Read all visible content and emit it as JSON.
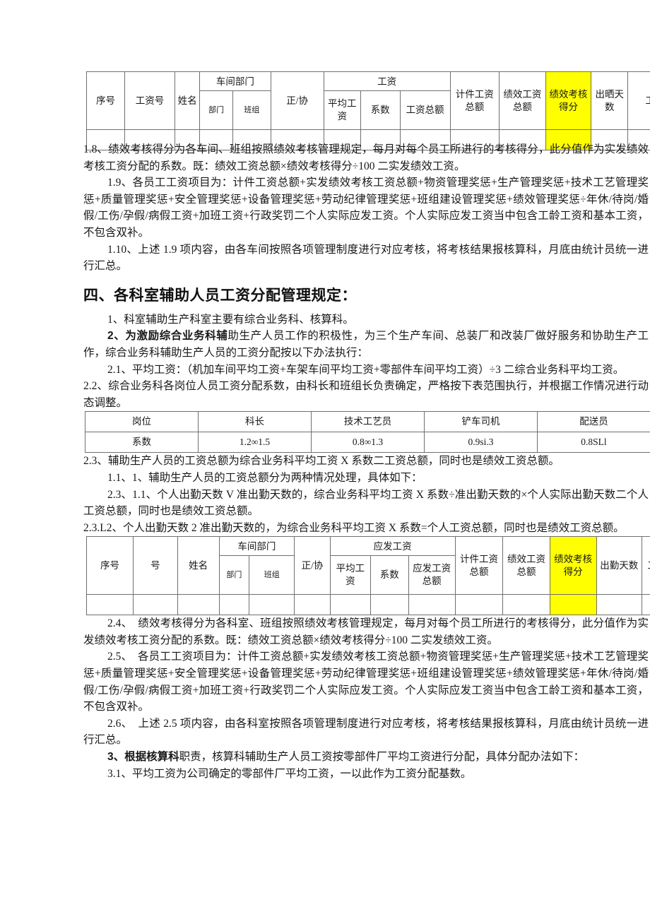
{
  "document": {
    "language": "zh-CN",
    "page_bg": "#ffffff",
    "text_color": "#1a1a1a",
    "highlight_color": "#ffff00",
    "border_color": "#6f6f6f"
  },
  "table1": {
    "name": "workshop-employee-wage-table",
    "group_headers": {
      "workshop_dept": "车间部门",
      "wage": "工资"
    },
    "headers": [
      "序号",
      "工资号",
      "姓名",
      "部门",
      "班组",
      "正/协",
      "平均工资",
      "系数",
      "工资总额",
      "计件工资总额",
      "绩效工资总额",
      "绩效考核得分",
      "出晒天数",
      "工"
    ],
    "highlighted_header": "绩效考核得分",
    "rows": [
      [
        "",
        "",
        "",
        "",
        "",
        "",
        "",
        "",
        "",
        "",
        "",
        "",
        "",
        ""
      ]
    ]
  },
  "paragraphs": {
    "p1_8": "1.8、绩效考核得分为各车间、班组按照绩效考核管理规定，每月对每个员工所进行的考核得分，此分值作为实发绩效考核工资分配的系数。既：绩效工资总额×绩效考核得分÷100 二实发绩效工资。",
    "p1_9": "1.9、各员工工资项目为：计件工资总额+实发绩效考核工资总额+物资管理奖惩+生产管理奖惩+技术工艺管理奖惩+质量管理奖惩+安全管理奖惩+设备管理奖惩+劳动纪律管理奖惩+班组建设管理奖惩+绩效管理奖惩÷年休/待岗/婚假/工伤/孕假/病假工资+加班工资+行政奖罚二个人实际应发工资。个人实际应发工资当中包含工龄工资和基本工资，不包含双补。",
    "p1_10": "1.10、上述 1.9 项内容，由各车间按照各项管理制度进行对应考核，将考核结果报核算科，月底由统计员统一进行汇总。",
    "heading4": "四、各科室辅助人员工资分配管理规定：",
    "p1": "1、科室辅助生产科室主要有综合业务科、核算科。",
    "p2_bold": "2、为激励综合业务科辅",
    "p2_rest": "助生产人员工作的积极性，为三个生产车间、总装厂和改装厂做好服务和协助生产工作，综合业务科辅助生产人员的工资分配按以下办法执行：",
    "p2_1": "2.1、平均工资：（机加车间平均工资+车架车间平均工资+零部件车间平均工资）÷3 二综合业务科平均工资。",
    "p2_2": "2.2、综合业务科各岗位人员工资分配系数，由科长和班组长负责确定，严格按下表范围执行，并根据工作情况进行动态调整。",
    "p2_3": "2.3、辅助生产人员的工资总额为综合业务科平均工资 X 系数二工资总额，同时也是绩效工资总额。",
    "p1_1": "1.1、1、辅助生产人员的工资总额分为两种情况处理，具体如下：",
    "p2_3_1_1": "2.3、1.1、个人出勤天数 V 准出勤天数的，综合业务科平均工资 X 系数÷准出勤天数的×个人实际出勤天数二个人工资总额，同时也是绩效工资总额。",
    "p2_3_l2": "2.3.L2、个人出勤天数 2 准出勤天数的，为综合业务科平均工资 X 系数=个人工资总额，同时也是绩效工资总额。",
    "p2_4": "2.4、　绩效考核得分为各科室、班组按照绩效考核管理规定，每月对每个员工所进行的考核得分，此分值作为实发绩效考核工资分配的系数。既：绩效工资总额×绩效考核得分÷100 二实发绩效工资。",
    "p2_5": "2.5、　各员工工资项目为：计件工资总额+实发绩效考核工资总额+物资管理奖惩+生产管理奖惩+技术工艺管理奖惩+质量管理奖惩+安全管理奖惩+设备管理奖惩+劳动纪律管理奖惩+班组建设管理奖惩+绩效管理奖惩+年休/待岗/婚假/工伤/孕假/病假工资+加班工资+行政奖罚二个人实际应发工资。个人实际应发工资当中包含工龄工资和基本工资，不包含双补。",
    "p2_6": "2.6、　上述 2.5 项内容，由各科室按照各项管理制度进行对应考核，将考核结果报核算科，月底由统计员统一进行汇总。",
    "p3_bold": "3、根据核算科",
    "p3_rest": "职责，核算科辅助生产人员工资按零部件厂平均工资进行分配，具体分配办法如下：",
    "p3_1": "3.1、平均工资为公司确定的零部件厂平均工资，一以此作为工资分配基数。"
  },
  "table_coefficient": {
    "name": "position-coefficient-table",
    "row_labels": [
      "岗位",
      "系数"
    ],
    "positions": [
      "科长",
      "技术工艺员",
      "铲车司机",
      "配送员"
    ],
    "coefficients": [
      "1.2∞1.5",
      "0.8∞1.3",
      "0.9si.3",
      "0.8SLl"
    ]
  },
  "table2": {
    "name": "department-assistant-wage-table",
    "group_headers": {
      "workshop_dept": "车间部门",
      "payable_wage": "应发工资"
    },
    "headers": [
      "序号",
      "号",
      "姓名",
      "部门",
      "班组",
      "正/协",
      "平均工资",
      "系数",
      "应发工资总额",
      "计件工资总额",
      "绩效工资总额",
      "绩效考核得分",
      "出勤天数",
      "工龄"
    ],
    "highlighted_header": "绩效考核得分",
    "rows": [
      [
        "",
        "",
        "",
        "",
        "",
        "",
        "",
        "",
        "",
        "",
        "",
        "",
        "",
        ""
      ]
    ]
  }
}
